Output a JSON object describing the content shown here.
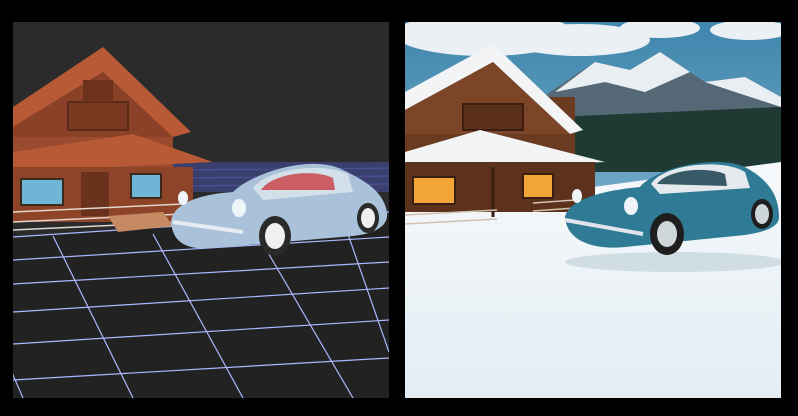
{
  "figure": {
    "panels": [
      {
        "id": "left",
        "kind": "3d-viewport-render",
        "subject": "cabin-and-classic-car-on-grid-floor"
      },
      {
        "id": "right",
        "kind": "photoreal-render",
        "subject": "cabin-and-classic-car-in-snowy-mountains"
      }
    ]
  },
  "colors": {
    "background": "#000000",
    "viewport_bg": "#2b2b2b",
    "grid_line": "#aab8ff",
    "cabin_wood_left": "#9a4a2e",
    "car_left": "#a9c2d9",
    "sky": "#6aa8c9",
    "snow": "#eef3f7",
    "car_right": "#2f7b95",
    "cabin_wood_right": "#6a3a21",
    "window_glow": "#f2a436"
  }
}
